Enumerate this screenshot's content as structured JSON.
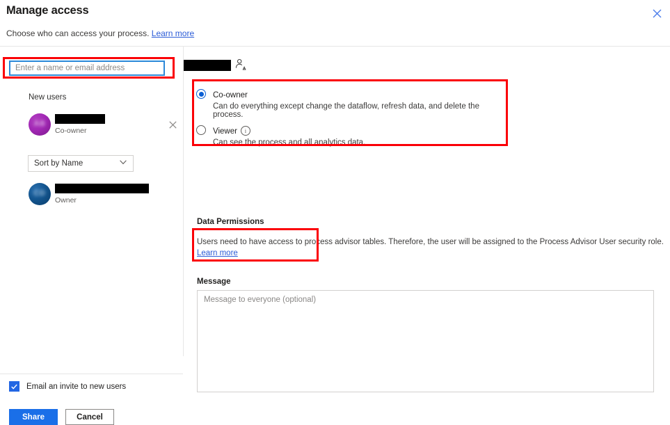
{
  "header": {
    "title": "Manage access",
    "subtitle": "Choose who can access your process.",
    "learn_more": "Learn more",
    "close_icon": "close-icon"
  },
  "left": {
    "search": {
      "placeholder": "Enter a name or email address",
      "value": ""
    },
    "section_label": "New users",
    "new_user": {
      "name": "",
      "role": "Co-owner",
      "avatar_initials": "AB",
      "avatar_color": "#a228b5",
      "remove_icon": "close-icon"
    },
    "sort": {
      "selected": "Sort by Name",
      "chevron_icon": "chevron-down-icon"
    },
    "existing_user": {
      "name": "",
      "name_tail": ")",
      "role": "Owner",
      "avatar_initials": "CD",
      "avatar_color": "#13558f"
    },
    "email_invite": {
      "label": "Email an invite to new users",
      "checked": true,
      "check_icon": "checkmark-icon"
    },
    "buttons": {
      "share": "Share",
      "cancel": "Cancel"
    }
  },
  "right": {
    "selected_user": {
      "name": "",
      "icon": "person-permission-icon"
    },
    "permissions": [
      {
        "label": "Co-owner",
        "description": "Can do everything except change the dataflow, refresh data, and delete the process.",
        "selected": true,
        "info_icon": null
      },
      {
        "label": "Viewer",
        "description": "Can see the process and all analytics data.",
        "selected": false,
        "info_icon": "info-icon"
      }
    ],
    "data_permissions": {
      "title": "Data Permissions",
      "text": "Users need to have access to process advisor tables. Therefore, the user will be assigned to the Process Advisor User security role. ",
      "learn_more": "Learn more"
    },
    "message": {
      "label": "Message",
      "placeholder": "Message to everyone (optional)",
      "value": ""
    }
  },
  "colors": {
    "accent": "#1a6fe8",
    "link": "#2a5bd7",
    "annotation": "#fb0007",
    "radio_selected": "#0b5fd4"
  }
}
